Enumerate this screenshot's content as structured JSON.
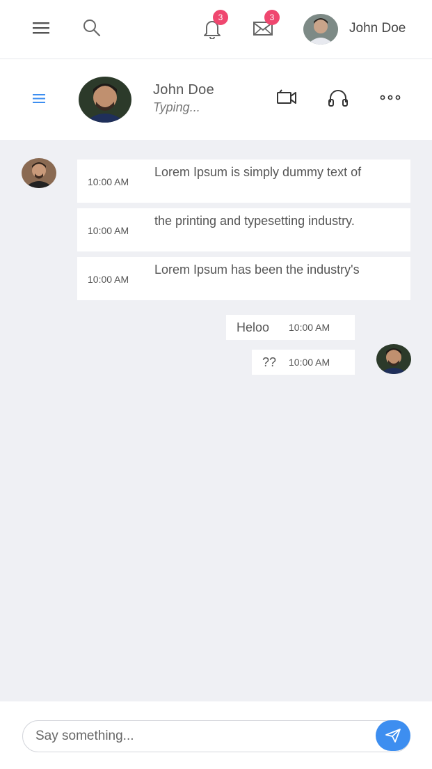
{
  "topbar": {
    "notifications_count": "3",
    "messages_count": "3",
    "user_name": "John Doe"
  },
  "chat_header": {
    "contact_name": "John Doe",
    "contact_status": "Typing..."
  },
  "messages": {
    "incoming": [
      {
        "time": "10:00 AM",
        "text": "Lorem Ipsum is simply dummy text of"
      },
      {
        "time": "10:00 AM",
        "text": "the printing and typesetting industry."
      },
      {
        "time": "10:00 AM",
        "text": "Lorem Ipsum has been the industry's"
      }
    ],
    "outgoing": [
      {
        "text": "Heloo",
        "time": "10:00 AM"
      },
      {
        "text": "??",
        "time": "10:00 AM"
      }
    ]
  },
  "composer": {
    "placeholder": "Say something..."
  },
  "colors": {
    "accent": "#3d8ef0",
    "badge": "#ef476f",
    "chat_background": "#eff0f4"
  },
  "icons": [
    "menu-icon",
    "search-icon",
    "bell-icon",
    "mail-icon",
    "video-camera-icon",
    "headphones-icon",
    "more-icon",
    "send-icon"
  ]
}
